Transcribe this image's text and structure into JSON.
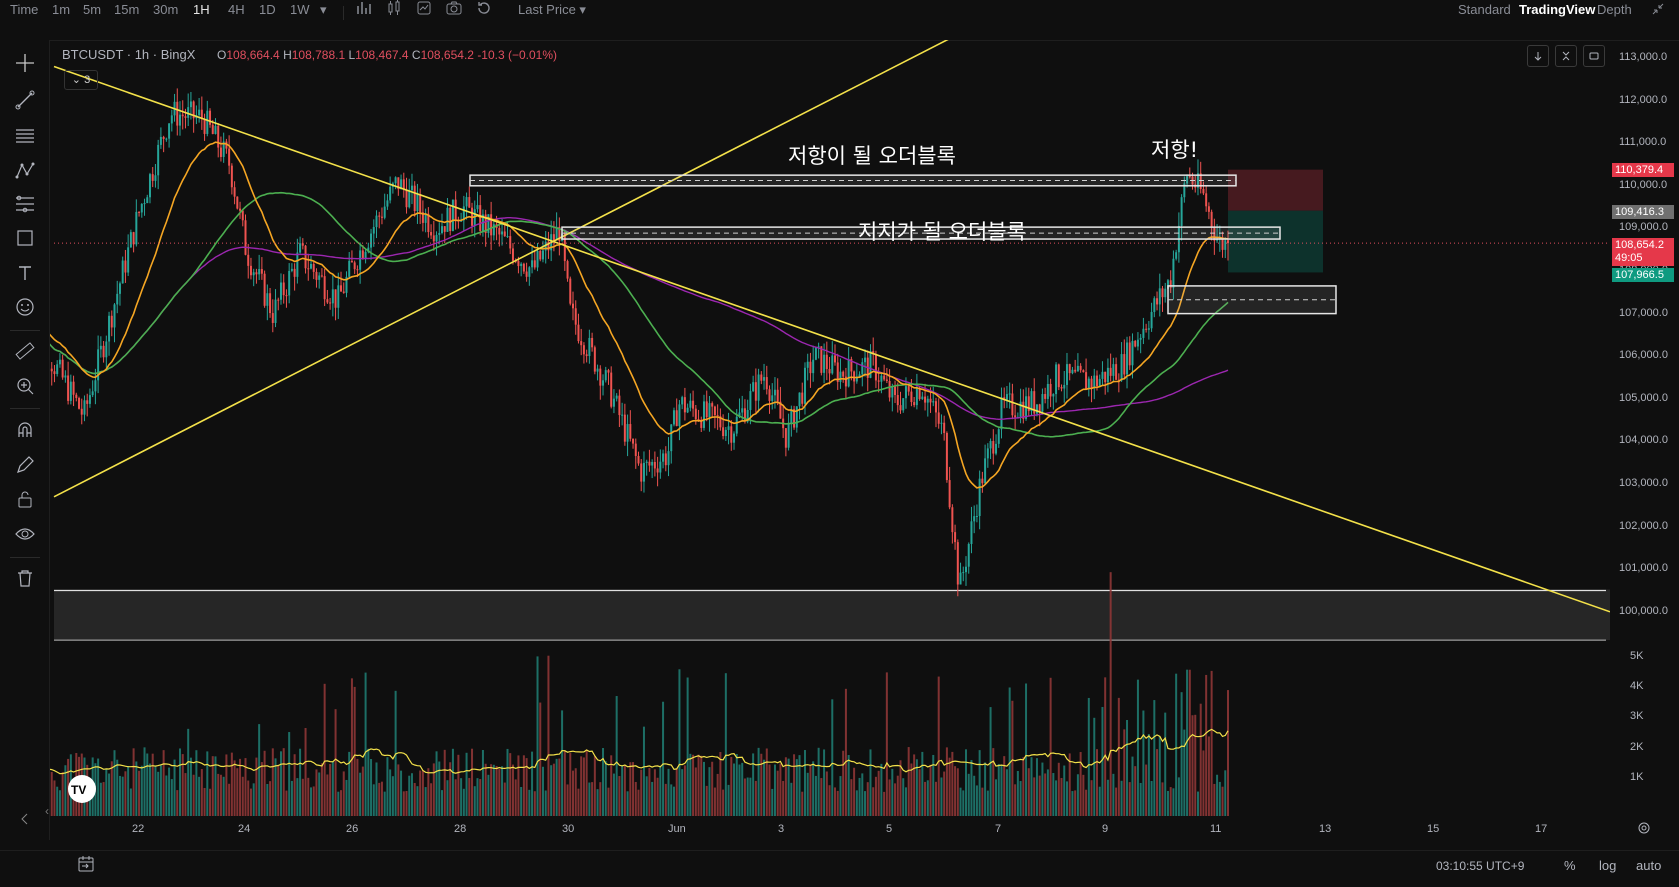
{
  "toolbar": {
    "time": "Time",
    "intervals": [
      "1m",
      "5m",
      "15m",
      "30m",
      "1H",
      "4H",
      "1D",
      "1W"
    ],
    "active_interval": "1H",
    "last_price": "Last Price",
    "views": {
      "standard": "Standard",
      "tradingview": "TradingView",
      "depth": "Depth"
    }
  },
  "legend": {
    "symbol": "BTCUSDT · 1h · BingX",
    "o_key": "O",
    "o": "108,664.4",
    "h_key": "H",
    "h": "108,788.1",
    "l_key": "L",
    "l": "108,467.4",
    "c_key": "C",
    "c": "108,654.2",
    "change": "-10.3 (−0.01%)",
    "indicator_count": "3"
  },
  "annotations": {
    "resistance_block": "저항이 될 오더블록",
    "support_block": "지지가 될 오더블록",
    "resistance_hit": "저항!"
  },
  "price_axis": [
    "113,000.0",
    "112,000.0",
    "111,000.0",
    "110,000.0",
    "109,000.0",
    "108,000.0",
    "107,000.0",
    "106,000.0",
    "105,000.0",
    "104,000.0",
    "103,000.0",
    "102,000.0",
    "101,000.0",
    "100,000.0"
  ],
  "price_tags": {
    "stop": "110,379.4",
    "entry": "109,416.3",
    "last": "108,654.2",
    "countdown": "49:05",
    "target": "107,966.5"
  },
  "volume_axis": [
    "5K",
    "4K",
    "3K",
    "2K",
    "1K"
  ],
  "time_axis": [
    "22",
    "24",
    "26",
    "28",
    "30",
    "Jun",
    "3",
    "5",
    "7",
    "9",
    "11",
    "13",
    "15",
    "17"
  ],
  "bottom": {
    "clock": "03:10:55 UTC+9",
    "percent": "%",
    "log": "log",
    "auto": "auto"
  },
  "colors": {
    "up": "#26a69a",
    "down": "#ef5350",
    "ma_fast": "#f5a623",
    "ma_mid": "#4caf50",
    "ma_slow": "#9c27b0",
    "trendline": "#f3e14a"
  },
  "chart_data": {
    "type": "candlestick",
    "symbol": "BTCUSDT",
    "interval": "1h",
    "exchange": "BingX",
    "ylim": [
      99500,
      113300
    ],
    "x_ticks": [
      "22",
      "24",
      "26",
      "28",
      "30",
      "Jun",
      "3",
      "5",
      "7",
      "9",
      "11",
      "13",
      "15",
      "17"
    ],
    "price_path": [
      {
        "t": "20",
        "price": 106800
      },
      {
        "t": "21",
        "price": 104600
      },
      {
        "t": "22",
        "price": 109300
      },
      {
        "t": "22.6",
        "price": 111700
      },
      {
        "t": "23.2",
        "price": 111600
      },
      {
        "t": "23.7",
        "price": 110500
      },
      {
        "t": "24",
        "price": 108500
      },
      {
        "t": "24.5",
        "price": 107000
      },
      {
        "t": "25",
        "price": 108400
      },
      {
        "t": "25.7",
        "price": 107300
      },
      {
        "t": "26",
        "price": 108200
      },
      {
        "t": "26.8",
        "price": 110100
      },
      {
        "t": "27.5",
        "price": 109000
      },
      {
        "t": "28",
        "price": 109500
      },
      {
        "t": "28.7",
        "price": 108800
      },
      {
        "t": "29.3",
        "price": 108000
      },
      {
        "t": "29.8",
        "price": 109000
      },
      {
        "t": "30",
        "price": 107000
      },
      {
        "t": "30.7",
        "price": 105300
      },
      {
        "t": "31.3",
        "price": 103300
      },
      {
        "t": "31.8",
        "price": 103700
      },
      {
        "t": "Jun",
        "price": 104900
      },
      {
        "t": "2",
        "price": 104300
      },
      {
        "t": "2.6",
        "price": 105600
      },
      {
        "t": "3",
        "price": 104100
      },
      {
        "t": "3.5",
        "price": 106000
      },
      {
        "t": "4",
        "price": 105600
      },
      {
        "t": "4.6",
        "price": 105800
      },
      {
        "t": "5",
        "price": 104900
      },
      {
        "t": "5.5",
        "price": 105300
      },
      {
        "t": "5.9",
        "price": 104200
      },
      {
        "t": "6.2",
        "price": 100500
      },
      {
        "t": "6.6",
        "price": 103100
      },
      {
        "t": "7",
        "price": 104800
      },
      {
        "t": "7.6",
        "price": 104900
      },
      {
        "t": "8",
        "price": 105500
      },
      {
        "t": "8.7",
        "price": 105400
      },
      {
        "t": "9.2",
        "price": 105800
      },
      {
        "t": "9.6",
        "price": 106700
      },
      {
        "t": "10.1",
        "price": 107800
      },
      {
        "t": "10.4",
        "price": 110300
      },
      {
        "t": "10.7",
        "price": 109800
      },
      {
        "t": "11",
        "price": 108654
      }
    ],
    "order_blocks": [
      {
        "label": "저항이 될 오더블록",
        "low": 110000,
        "high": 110250
      },
      {
        "label": "지지가 될 오더블록",
        "low": 108750,
        "high": 109030
      },
      {
        "label": "",
        "low": 107000,
        "high": 107650
      },
      {
        "label": "",
        "low": 99500,
        "high": 100500
      }
    ],
    "position": {
      "stop": 110379.4,
      "entry": 109416.3,
      "target": 107966.5
    },
    "last_price": 108654.2,
    "volume_ylim": [
      0,
      5500
    ],
    "volume_ticks": [
      "5K",
      "4K",
      "3K",
      "2K",
      "1K"
    ]
  }
}
